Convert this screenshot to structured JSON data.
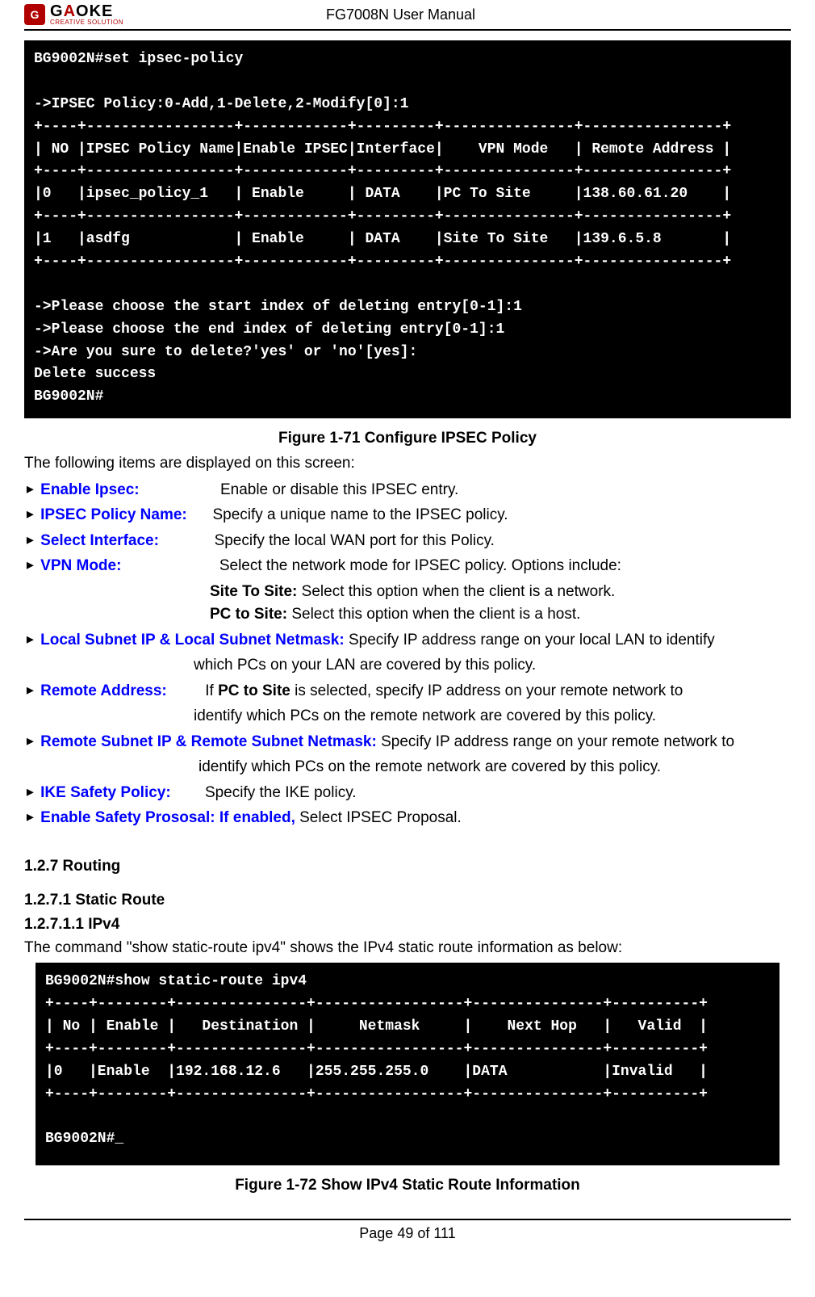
{
  "header": {
    "brand_left": "G",
    "brand_mid_red": "A",
    "brand_right": "OKE",
    "tagline": "CREATIVE SOLUTION",
    "doc_title": "FG7008N User Manual"
  },
  "terminal1": "BG9002N#set ipsec-policy\n\n->IPSEC Policy:0-Add,1-Delete,2-Modify[0]:1\n+----+-----------------+------------+---------+---------------+----------------+\n| NO |IPSEC Policy Name|Enable IPSEC|Interface|    VPN Mode   | Remote Address |\n+----+-----------------+------------+---------+---------------+----------------+\n|0   |ipsec_policy_1   | Enable     | DATA    |PC To Site     |138.60.61.20    |\n+----+-----------------+------------+---------+---------------+----------------+\n|1   |asdfg            | Enable     | DATA    |Site To Site   |139.6.5.8       |\n+----+-----------------+------------+---------+---------------+----------------+\n\n->Please choose the start index of deleting entry[0-1]:1\n->Please choose the end index of deleting entry[0-1]:1\n->Are you sure to delete?'yes' or 'no'[yes]:\nDelete success\nBG9002N#",
  "caption1": "Figure 1-71    Configure IPSEC Policy",
  "intro1": "The following items are displayed on this screen:",
  "items": {
    "enable_ipsec_label": "Enable Ipsec:",
    "enable_ipsec_desc": "Enable or disable this IPSEC entry.",
    "policy_name_label": "IPSEC Policy Name:",
    "policy_name_desc": "Specify a unique name to the IPSEC policy.",
    "select_if_label": "Select Interface:",
    "select_if_desc": "Specify the local WAN port for this Policy.",
    "vpn_mode_label": "VPN Mode:",
    "vpn_mode_desc": "Select the network mode for IPSEC policy. Options include:",
    "site_label": "Site To Site:",
    "site_desc": " Select this option when the client is a network.",
    "pc_label": "PC to Site:",
    "pc_desc": " Select this option when the client is a host.",
    "local_subnet_label": "Local Subnet IP & Local Subnet Netmask:",
    "local_subnet_desc_a": " Specify IP address range on your local LAN to identify",
    "local_subnet_desc_b": "which PCs on your LAN are covered by this policy.",
    "remote_addr_label": "Remote Address:",
    "remote_addr_desc_a_prefix": "If ",
    "remote_addr_desc_a_bold": "PC to Site",
    "remote_addr_desc_a_suffix": " is selected, specify IP address on your remote network to",
    "remote_addr_desc_b": "identify which PCs on the remote network are covered by this policy.",
    "remote_subnet_label": "Remote Subnet IP & Remote Subnet Netmask:",
    "remote_subnet_desc_a": " Specify IP address range on your remote network to",
    "remote_subnet_desc_b": "identify which PCs on the remote network are covered by this policy.",
    "ike_label": "IKE Safety Policy:",
    "ike_desc": "Specify the IKE policy.",
    "proposal_label": "Enable Safety Prososal:",
    "proposal_blue_extra": " If enabled,",
    "proposal_desc": " Select IPSEC Proposal."
  },
  "h127": "1.2.7    Routing",
  "h1271": "1.2.7.1    Static Route",
  "h12711": "1.2.7.1.1    IPv4",
  "intro2": "The command \"show static-route ipv4\" shows the IPv4 static route information as below:",
  "terminal2": "BG9002N#show static-route ipv4\n+----+--------+---------------+-----------------+---------------+----------+\n| No | Enable |   Destination |     Netmask     |    Next Hop   |   Valid  |\n+----+--------+---------------+-----------------+---------------+----------+\n|0   |Enable  |192.168.12.6   |255.255.255.0    |DATA           |Invalid   |\n+----+--------+---------------+-----------------+---------------+----------+\n\nBG9002N#_",
  "caption2": "Figure 1-72    Show IPv4 Static Route Information",
  "footer": "Page 49 of 111"
}
